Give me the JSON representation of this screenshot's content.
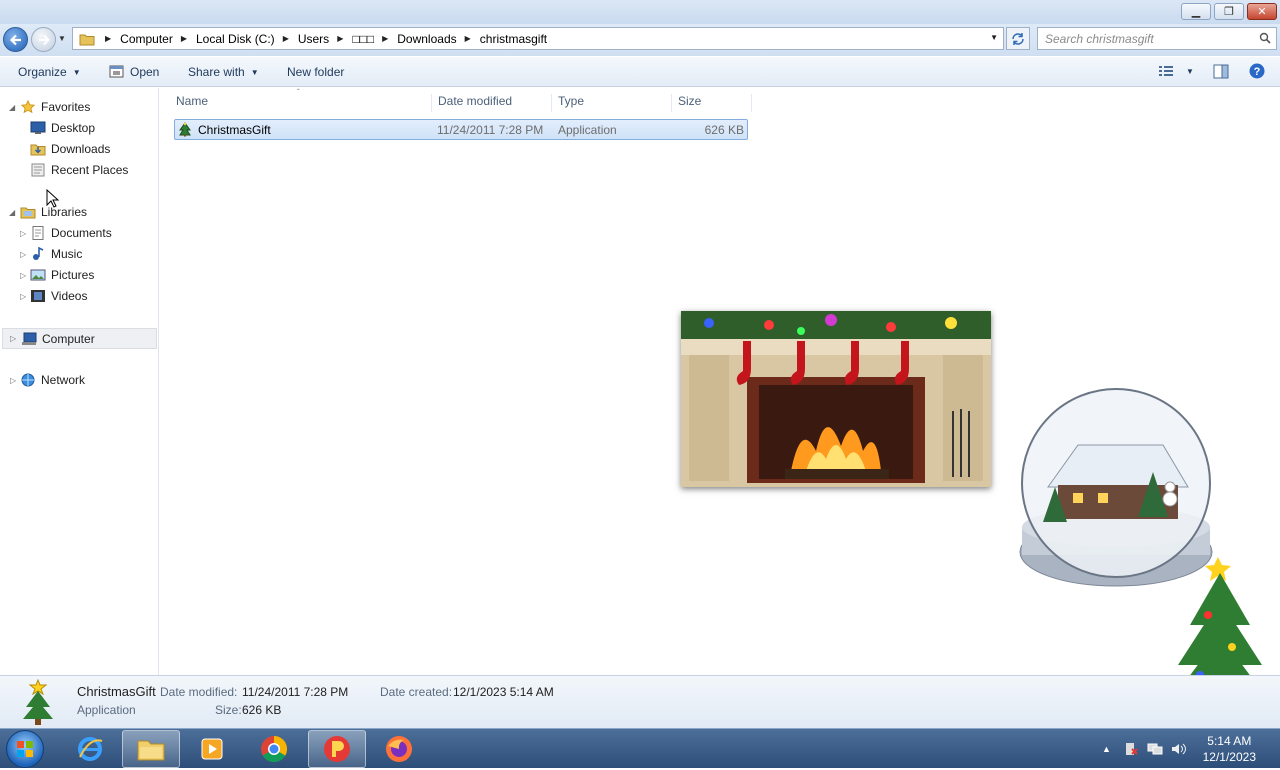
{
  "window": {
    "caption_buttons": {
      "minimize": "▁",
      "maximize": "❐",
      "close": "✕"
    }
  },
  "navigation": {
    "breadcrumbs": [
      "Computer",
      "Local Disk (C:)",
      "Users",
      "□□□",
      "Downloads",
      "christmasgift"
    ],
    "search_placeholder": "Search christmasgift"
  },
  "toolbar": {
    "organize": "Organize",
    "open": "Open",
    "share_with": "Share with",
    "new_folder": "New folder"
  },
  "nav_pane": {
    "favorites": {
      "label": "Favorites",
      "items": [
        "Desktop",
        "Downloads",
        "Recent Places"
      ]
    },
    "libraries": {
      "label": "Libraries",
      "items": [
        "Documents",
        "Music",
        "Pictures",
        "Videos"
      ]
    },
    "computer": "Computer",
    "network": "Network"
  },
  "file_list": {
    "columns": [
      "Name",
      "Date modified",
      "Type",
      "Size"
    ],
    "rows": [
      {
        "name": "ChristmasGift",
        "date_modified": "11/24/2011 7:28 PM",
        "type": "Application",
        "size": "626 KB"
      }
    ]
  },
  "details": {
    "name": "ChristmasGift",
    "type": "Application",
    "date_modified_label": "Date modified:",
    "date_modified": "11/24/2011 7:28 PM",
    "size_label": "Size:",
    "size": "626 KB",
    "date_created_label": "Date created:",
    "date_created": "12/1/2023 5:14 AM"
  },
  "taskbar": {
    "time": "5:14 AM",
    "date": "12/1/2023",
    "apps": [
      "ie-icon",
      "explorer-icon",
      "media-player-icon",
      "chrome-icon",
      "app-icon",
      "firefox-icon"
    ]
  },
  "colors": {
    "selection": "#cfe2f8",
    "taskbar": "#2d4e78",
    "toolbar_text": "#1e395b"
  }
}
